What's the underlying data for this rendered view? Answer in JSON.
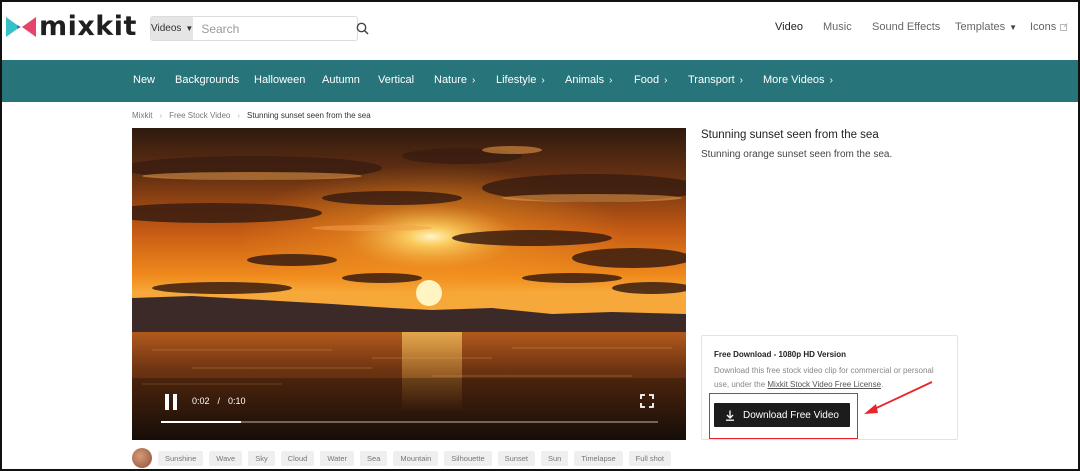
{
  "header": {
    "logo_text": "mixkit",
    "search": {
      "category": "Videos",
      "placeholder": "Search"
    },
    "nav": [
      {
        "label": "Video"
      },
      {
        "label": "Music"
      },
      {
        "label": "Sound Effects"
      },
      {
        "label": "Templates"
      },
      {
        "label": "Icons"
      }
    ]
  },
  "categories": [
    {
      "label": "New",
      "chevron": false
    },
    {
      "label": "Backgrounds",
      "chevron": false
    },
    {
      "label": "Halloween",
      "chevron": false
    },
    {
      "label": "Autumn",
      "chevron": false
    },
    {
      "label": "Vertical",
      "chevron": false
    },
    {
      "label": "Nature",
      "chevron": true
    },
    {
      "label": "Lifestyle",
      "chevron": true
    },
    {
      "label": "Animals",
      "chevron": true
    },
    {
      "label": "Food",
      "chevron": true
    },
    {
      "label": "Transport",
      "chevron": true
    },
    {
      "label": "More Videos",
      "chevron": true
    }
  ],
  "breadcrumb": [
    "Mixkit",
    "Free Stock Video",
    "Stunning sunset seen from the sea"
  ],
  "video": {
    "current_time": "0:02",
    "separator": "/",
    "duration": "0:10",
    "progress": 0.16
  },
  "tags": [
    "Sunshine",
    "Wave",
    "Sky",
    "Cloud",
    "Water",
    "Sea",
    "Mountain",
    "Silhouette",
    "Sunset",
    "Sun",
    "Timelapse",
    "Full shot"
  ],
  "details": {
    "title": "Stunning sunset seen from the sea",
    "description": "Stunning orange sunset seen from the sea.",
    "download": {
      "heading": "Free Download - 1080p HD Version",
      "text_before": "Download this free stock video clip for commercial or personal use, under the ",
      "license_link": "Mixkit Stock Video Free License",
      "text_after": ".",
      "button_label": "Download Free Video"
    }
  },
  "colors": {
    "nav_bg": "#27757a",
    "highlight": "#e8262a",
    "button_bg": "#1c1c1c"
  }
}
